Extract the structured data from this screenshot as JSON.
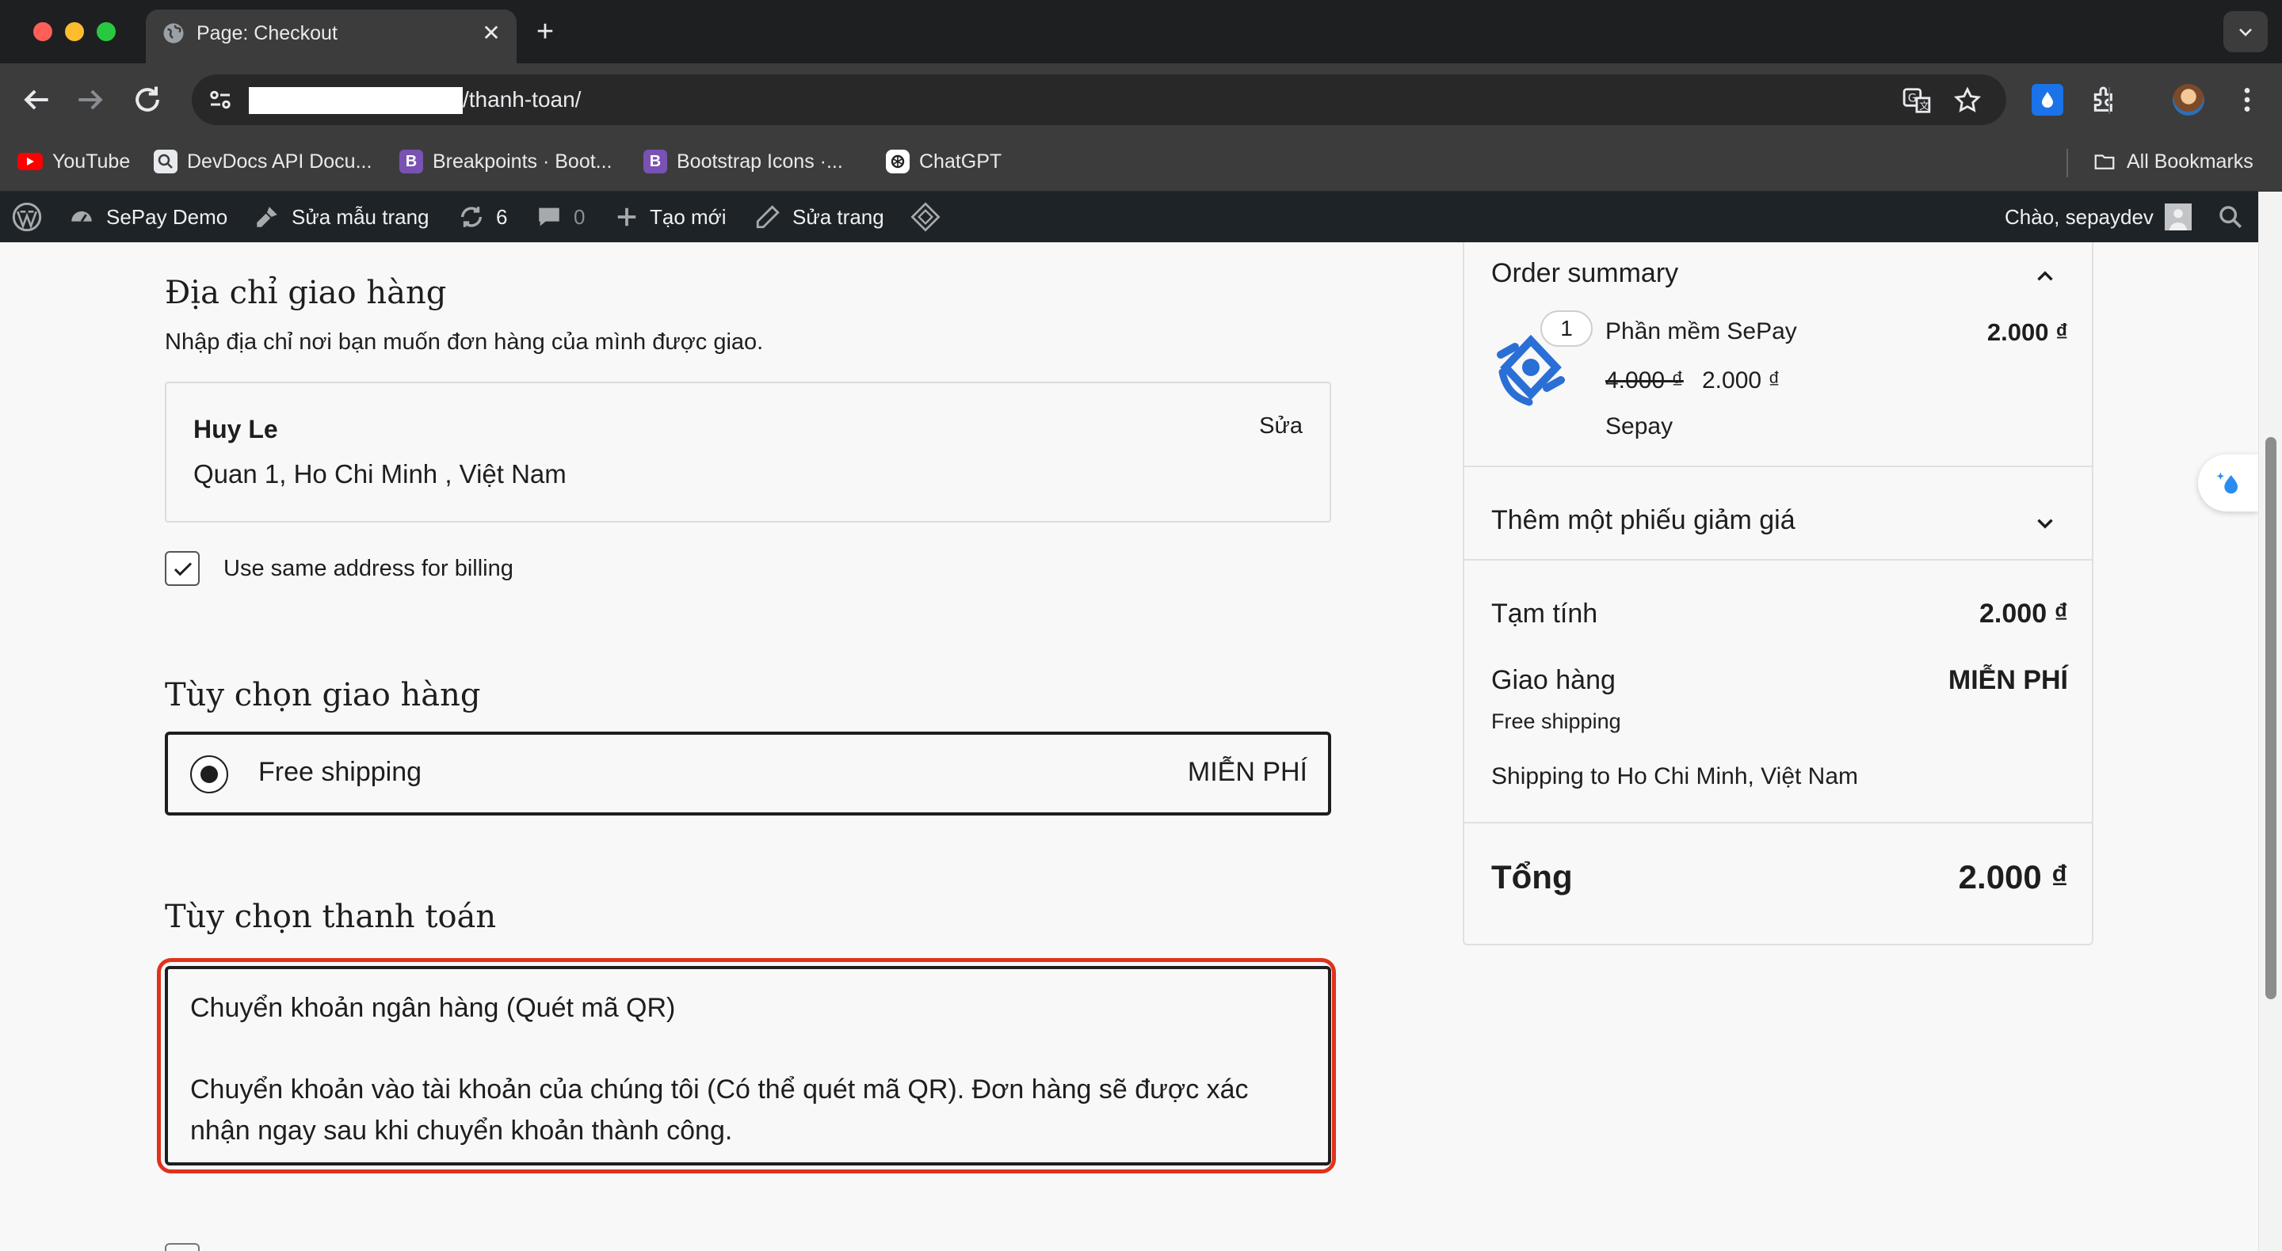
{
  "browser": {
    "tab_title": "Page: Checkout",
    "tab_close": "✕",
    "new_tab": "+",
    "url_path": "/thanh-toan/",
    "bookmarks": [
      {
        "label": "YouTube",
        "icon": "youtube-icon"
      },
      {
        "label": "DevDocs API Docu...",
        "icon": "devdocs-icon"
      },
      {
        "label": "Breakpoints · Boot...",
        "icon": "bootstrap-icon",
        "glyph": "B"
      },
      {
        "label": "Bootstrap Icons ·...",
        "icon": "bootstrap-icon",
        "glyph": "B"
      },
      {
        "label": "ChatGPT",
        "icon": "chatgpt-icon"
      }
    ],
    "all_bookmarks": "All Bookmarks"
  },
  "wp_admin": {
    "site_name": "SePay Demo",
    "edit_template": "Sửa mẫu trang",
    "updates_count": "6",
    "comments_count": "0",
    "new": "Tạo mới",
    "edit_page": "Sửa trang",
    "greeting": "Chào, sepaydev"
  },
  "shipping_address": {
    "heading": "Địa chỉ giao hàng",
    "description": "Nhập địa chỉ nơi bạn muốn đơn hàng của mình được giao.",
    "name": "Huy Le",
    "address": "Quan 1, Ho Chi Minh , Việt Nam",
    "edit_label": "Sửa",
    "billing_same_label": "Use same address for billing",
    "billing_same_checked": true
  },
  "shipping_options": {
    "heading": "Tùy chọn giao hàng",
    "option_label": "Free shipping",
    "option_price": "MIỄN PHÍ",
    "selected": true
  },
  "payment_options": {
    "heading": "Tùy chọn thanh toán",
    "method_title": "Chuyển khoản ngân hàng (Quét mã QR)",
    "method_description": "Chuyển khoản vào tài khoản của chúng tôi (Có thể quét mã QR). Đơn hàng sẽ được xác nhận ngay sau khi chuyển khoản thành công."
  },
  "order_summary": {
    "title": "Order summary",
    "product": {
      "quantity": "1",
      "name": "Phần mềm SePay",
      "line_total": "2.000 ₫",
      "regular_price": "4.000 ₫",
      "sale_price": "2.000 ₫",
      "brand": "Sepay"
    },
    "coupon_label": "Thêm một phiếu giảm giá",
    "subtotal_label": "Tạm tính",
    "subtotal_value": "2.000 ₫",
    "shipping_label": "Giao hàng",
    "shipping_value": "MIỄN PHÍ",
    "shipping_method": "Free shipping",
    "shipping_destination": "Shipping to Ho Chi Minh, Việt Nam",
    "total_label": "Tổng",
    "total_value": "2.000 ₫"
  },
  "colors": {
    "highlight_outline": "#e0321c",
    "wp_bar": "#1d2327",
    "brand_blue": "#2a6fd6"
  }
}
